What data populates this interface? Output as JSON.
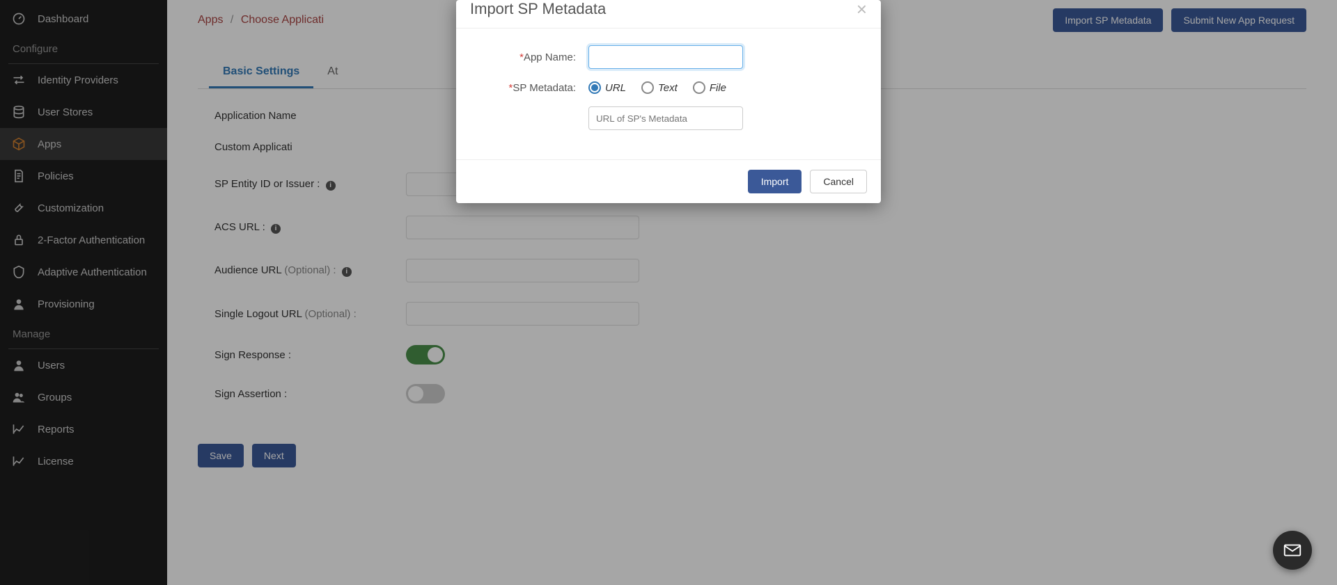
{
  "sidebar": {
    "dashboard": "Dashboard",
    "section_configure": "Configure",
    "identity_providers": "Identity Providers",
    "user_stores": "User Stores",
    "apps": "Apps",
    "policies": "Policies",
    "customization": "Customization",
    "two_factor": "2-Factor Authentication",
    "adaptive": "Adaptive Authentication",
    "provisioning": "Provisioning",
    "section_manage": "Manage",
    "users": "Users",
    "groups": "Groups",
    "reports": "Reports",
    "license": "License"
  },
  "breadcrumb": {
    "apps": "Apps",
    "choose": "Choose Applicati"
  },
  "header": {
    "import_btn": "Import SP Metadata",
    "submit_btn": "Submit New App Request"
  },
  "tabs": {
    "basic": "Basic Settings",
    "attr": "At"
  },
  "form": {
    "app_name": "Application Name",
    "custom_app": "Custom Applicati",
    "sp_entity": "SP Entity ID or Issuer :",
    "acs_url": "ACS URL :",
    "audience_url": "Audience URL",
    "audience_opt": "(Optional) :",
    "slo_url": "Single Logout URL",
    "slo_opt": "(Optional) :",
    "sign_response": "Sign Response :",
    "sign_assertion": "Sign Assertion :",
    "save": "Save",
    "next": "Next"
  },
  "modal": {
    "title": "Import SP Metadata",
    "app_name_label": "App Name:",
    "sp_metadata_label": "SP Metadata:",
    "radio_url": "URL",
    "radio_text": "Text",
    "radio_file": "File",
    "url_placeholder": "URL of SP's Metadata",
    "import_btn": "Import",
    "cancel_btn": "Cancel"
  }
}
